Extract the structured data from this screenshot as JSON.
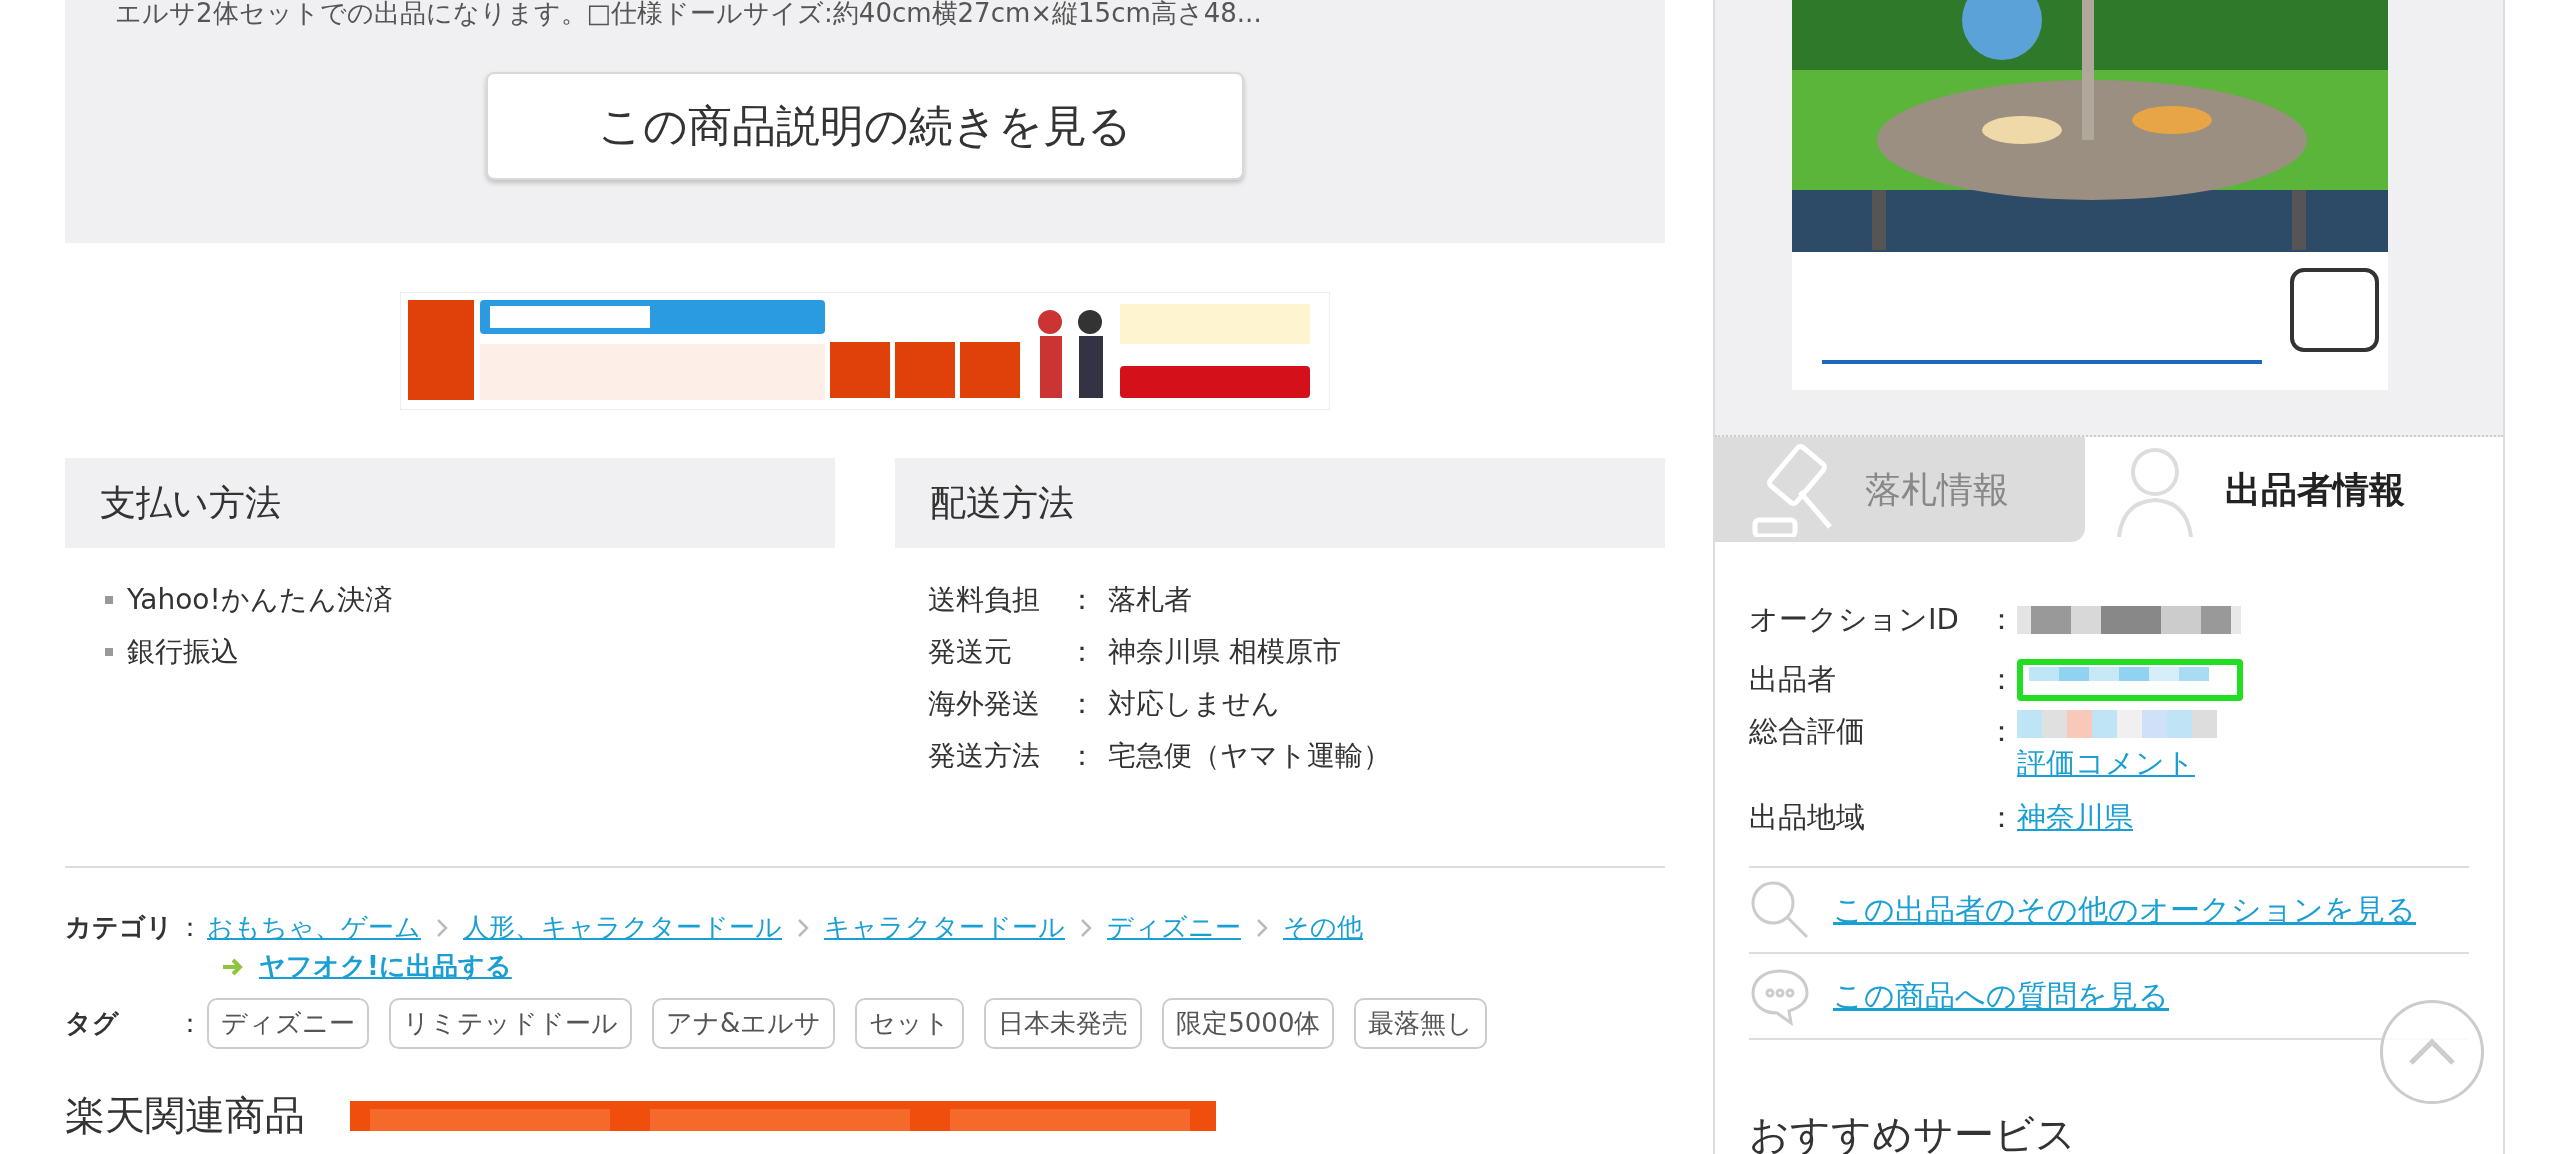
{
  "description": {
    "text": "エルサ2体セットでの出品になります。□仕様ドールサイズ:約40cm横27cm×縦15cm高さ48...",
    "more_button": "この商品説明の続きを見る"
  },
  "payment": {
    "title": "支払い方法",
    "items": [
      "Yahoo!かんたん決済",
      "銀行振込"
    ]
  },
  "shipping": {
    "title": "配送方法",
    "rows": [
      {
        "label": "送料負担",
        "colon": "：",
        "value": "落札者"
      },
      {
        "label": "発送元",
        "colon": "：",
        "value": "神奈川県 相模原市"
      },
      {
        "label": "海外発送",
        "colon": "：",
        "value": "対応しません"
      },
      {
        "label": "発送方法",
        "colon": "：",
        "value": "宅急便（ヤマト運輸）"
      }
    ]
  },
  "category": {
    "label": "カテゴリ",
    "colon": "：",
    "path": [
      "おもちゃ、ゲーム",
      "人形、キャラクタードール",
      "キャラクタードール",
      "ディズニー",
      "その他"
    ],
    "sell_link": "ヤフオク!に出品する"
  },
  "tags": {
    "label": "タグ",
    "colon": "：",
    "items": [
      "ディズニー",
      "リミテッドドール",
      "アナ&エルサ",
      "セット",
      "日本未発売",
      "限定5000体",
      "最落無し"
    ]
  },
  "related": {
    "title": "楽天関連商品"
  },
  "side_tabs": [
    {
      "label": "落札情報",
      "selected": false,
      "kind": "gavel"
    },
    {
      "label": "出品者情報",
      "selected": true,
      "kind": "person"
    }
  ],
  "seller_info": [
    {
      "label": "オークションID",
      "colon": "：",
      "kind": "blurred"
    },
    {
      "label": "出品者",
      "colon": "：",
      "kind": "highlighted"
    },
    {
      "label": "総合評価",
      "colon": "：",
      "kind": "rating",
      "link": "評価コメント"
    },
    {
      "label": "出品地域",
      "colon": "：",
      "kind": "link",
      "value": "神奈川県"
    }
  ],
  "seller_links": [
    {
      "kind": "search",
      "label": "この出品者のその他のオークションを見る"
    },
    {
      "kind": "chat",
      "label": "この商品への質問を見る"
    }
  ],
  "recommend": {
    "title": "おすすめサービス"
  }
}
